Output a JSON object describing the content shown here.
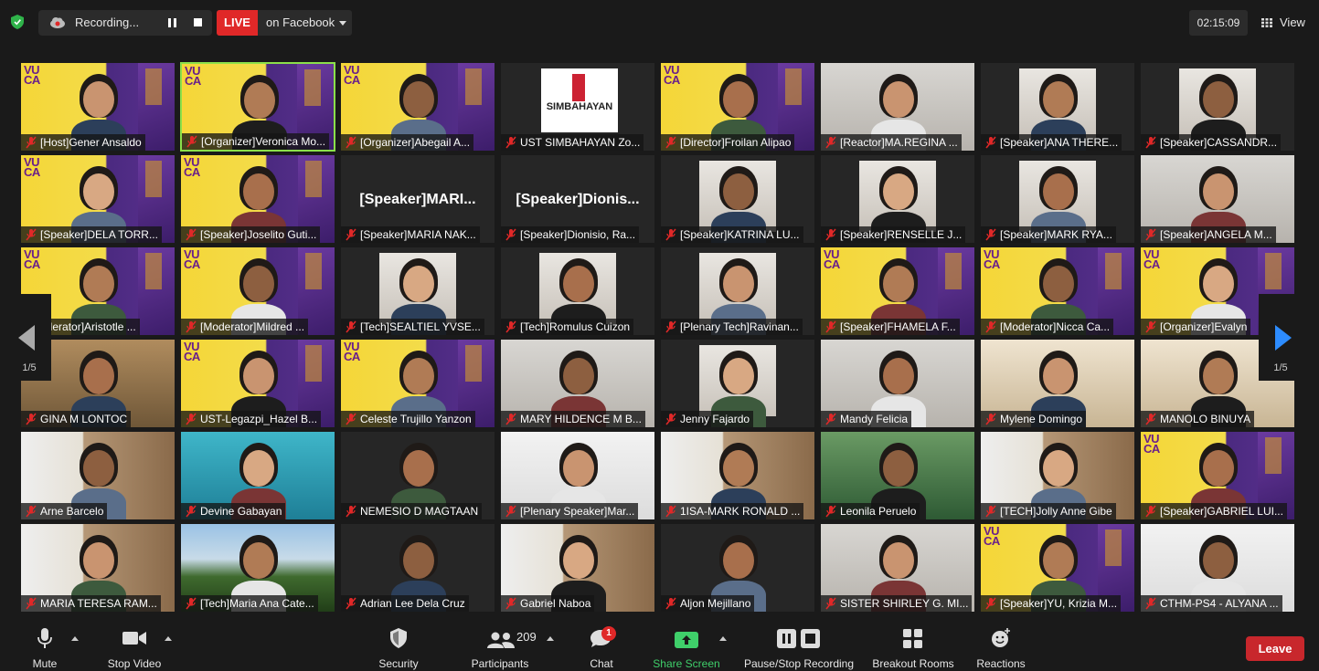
{
  "topbar": {
    "recording_label": "Recording...",
    "live_badge": "LIVE",
    "live_target": "on Facebook",
    "timer": "02:15:09",
    "view_label": "View"
  },
  "pages": {
    "left": "1/5",
    "right": "1/5"
  },
  "tiles": [
    {
      "name": "[Host]Gener Ansaldo",
      "bg": "vuca"
    },
    {
      "name": "[Organizer]Veronica Mo...",
      "bg": "vuca",
      "active": true
    },
    {
      "name": "[Organizer]Abegail A...",
      "bg": "vuca"
    },
    {
      "name": "UST SIMBAHAYAN Zo...",
      "bg": "logo",
      "logo_text": "SIMBAHAYAN"
    },
    {
      "name": "[Director]Froilan Alipao",
      "bg": "vuca"
    },
    {
      "name": "[Reactor]MA.REGINA ...",
      "bg": "room"
    },
    {
      "name": "[Speaker]ANA THERE...",
      "bg": "portrait"
    },
    {
      "name": "[Speaker]CASSANDR...",
      "bg": "portrait"
    },
    {
      "name": "[Speaker]DELA TORR...",
      "bg": "vuca"
    },
    {
      "name": "[Speaker]Joselito Guti...",
      "bg": "vuca"
    },
    {
      "name": "[Speaker]MARIA NAK...",
      "bg": "dark",
      "big_name": "[Speaker]MARI..."
    },
    {
      "name": "[Speaker]Dionisio, Ra...",
      "bg": "dark",
      "big_name": "[Speaker]Dionis..."
    },
    {
      "name": "[Speaker]KATRINA LU...",
      "bg": "portrait"
    },
    {
      "name": "[Speaker]RENSELLE J...",
      "bg": "portrait"
    },
    {
      "name": "[Speaker]MARK RYA...",
      "bg": "portrait"
    },
    {
      "name": "[Speaker]ANGELA M...",
      "bg": "room"
    },
    {
      "name": "oderator]Aristotle ...",
      "bg": "vuca"
    },
    {
      "name": "[Moderator]Mildred ...",
      "bg": "vuca"
    },
    {
      "name": "[Tech]SEALTIEL YVSE...",
      "bg": "portrait"
    },
    {
      "name": "[Tech]Romulus Cuizon",
      "bg": "portrait"
    },
    {
      "name": "[Plenary Tech]Ravinan...",
      "bg": "portrait"
    },
    {
      "name": "[Speaker]FHAMELA F...",
      "bg": "vuca"
    },
    {
      "name": "[Moderator]Nicca Ca...",
      "bg": "vuca"
    },
    {
      "name": "[Organizer]Evalyn",
      "bg": "vuca"
    },
    {
      "name": "GINA M LONTOC",
      "bg": "church"
    },
    {
      "name": "UST-Legazpi_Hazel B...",
      "bg": "vuca"
    },
    {
      "name": "Celeste Trujillo Yanzon",
      "bg": "vuca"
    },
    {
      "name": "MARY HILDENCE M B...",
      "bg": "room"
    },
    {
      "name": "Jenny Fajardo",
      "bg": "portrait"
    },
    {
      "name": "Mandy Felicia",
      "bg": "room"
    },
    {
      "name": "Mylene Domingo",
      "bg": "beige"
    },
    {
      "name": "MANOLO BINUYA",
      "bg": "beige"
    },
    {
      "name": "Arne Barcelo",
      "bg": "ust"
    },
    {
      "name": "Devine  Gabayan",
      "bg": "blue"
    },
    {
      "name": "NEMESIO D MAGTAAN",
      "bg": "dark"
    },
    {
      "name": "[Plenary Speaker]Mar...",
      "bg": "white"
    },
    {
      "name": "1ISA-MARK RONALD ...",
      "bg": "ust"
    },
    {
      "name": "Leonila Peruelo",
      "bg": "green"
    },
    {
      "name": "[TECH]Jolly Anne Gibe",
      "bg": "ust"
    },
    {
      "name": "[Speaker]GABRIEL LUI...",
      "bg": "vuca"
    },
    {
      "name": "MARIA TERESA RAM...",
      "bg": "ust"
    },
    {
      "name": "[Tech]Maria Ana Cate...",
      "bg": "mountain"
    },
    {
      "name": "Adrian Lee Dela Cruz",
      "bg": "dark"
    },
    {
      "name": "Gabriel Naboa",
      "bg": "ust"
    },
    {
      "name": "Aljon Mejillano",
      "bg": "dark"
    },
    {
      "name": "SISTER SHIRLEY G. MI...",
      "bg": "room"
    },
    {
      "name": "[Speaker]YU, Krizia M...",
      "bg": "vuca"
    },
    {
      "name": "CTHM-PS4 - ALYANA ...",
      "bg": "white"
    }
  ],
  "toolbar": {
    "mute": "Mute",
    "stop_video": "Stop Video",
    "security": "Security",
    "participants": "Participants",
    "participants_count": "209",
    "chat": "Chat",
    "chat_badge": "1",
    "share_screen": "Share Screen",
    "pause_stop_recording": "Pause/Stop Recording",
    "breakout_rooms": "Breakout Rooms",
    "reactions": "Reactions",
    "leave": "Leave"
  },
  "colors": {
    "background": "#1a1a1a",
    "live_red": "#e02828",
    "leave_red": "#c8272c",
    "share_green": "#3fcf6a",
    "active_speaker": "#8be04a",
    "page_arrow_blue": "#2d8cff"
  }
}
